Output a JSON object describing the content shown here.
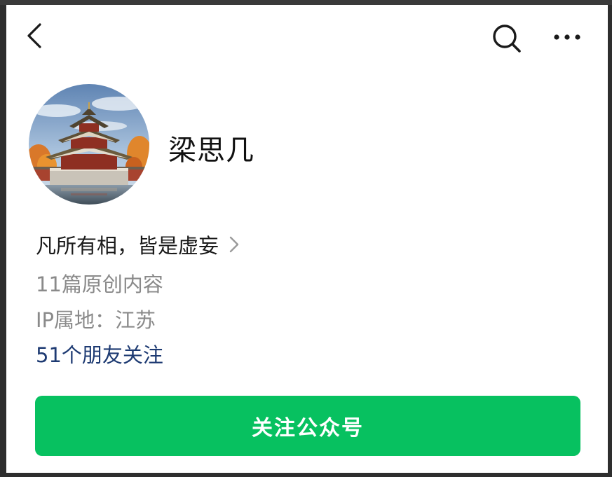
{
  "profile": {
    "name": "梁思几",
    "signature": "凡所有相，皆是虚妄",
    "original_articles": "11篇原创内容",
    "ip_location": "IP属地：江苏",
    "friends_following": "51个朋友关注"
  },
  "actions": {
    "follow_label": "关注公众号"
  },
  "icons": {
    "back": "back-arrow-icon",
    "search": "search-icon",
    "more": "more-options-icon",
    "signature_chevron": "chevron-right-icon"
  },
  "colors": {
    "accent_green": "#07c160",
    "link_blue": "#1d3a72",
    "secondary_text": "#8a8a8a",
    "primary_text": "#111111"
  }
}
